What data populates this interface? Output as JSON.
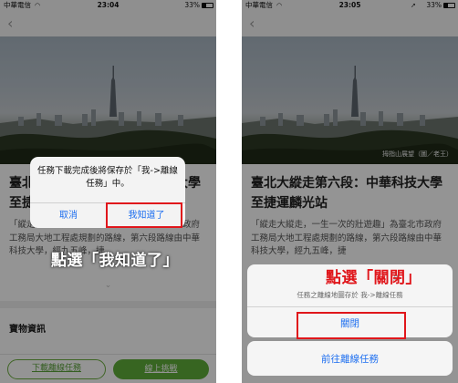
{
  "status_left": {
    "carrier": "中華電信",
    "wifi": "◠",
    "time": "23:04",
    "battery": "33%"
  },
  "status_right": {
    "carrier": "中華電信",
    "wifi": "◠",
    "time": "23:05",
    "location": "➚",
    "battery": "33%"
  },
  "nav": {
    "back_icon": "‹"
  },
  "hero": {
    "photo_credit": "拇指山展望（圖／老王）"
  },
  "article": {
    "title": "臺北大縱走第六段：中華科技大學至捷運麟光站",
    "body": "「縱走大縱走，一生一次的壯遊趣」為臺北市政府工務局大地工程處規劃的路線，第六段路線由中華科技大學，經九五峰，捷",
    "expand_icon": "⌄",
    "section_heading": "寶物資訊"
  },
  "buttons": {
    "download": "下載離線任務",
    "online": "線上挑戰"
  },
  "alert": {
    "message": "任務下載完成後將保存於「我->離線任務」中。",
    "cancel_label": "取消",
    "ok_label": "我知道了"
  },
  "caption_left": "點選「我知道了」",
  "sheet": {
    "small_label": "成",
    "message": "任務之離線地圖存於 我->離線任務",
    "close_label": "關閉",
    "goto_label": "前往離線任務"
  },
  "caption_right": "點選「關閉」",
  "colors": {
    "accent_green": "#5fae3a",
    "ios_blue": "#1e6ff0",
    "highlight_red": "#e0161b"
  }
}
